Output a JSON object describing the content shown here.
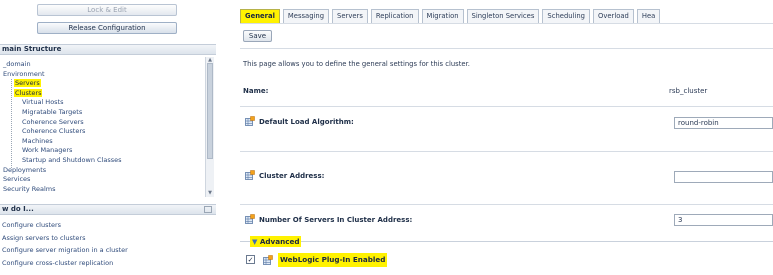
{
  "left": {
    "lock_edit_label": "Lock & Edit",
    "release_configuration_label": "Release Configuration",
    "domain_structure": {
      "title": "main Structure",
      "items": [
        {
          "label": "_domain",
          "indent": 0,
          "highlight": false
        },
        {
          "label": "Environment",
          "indent": 0,
          "highlight": false
        },
        {
          "label": "Servers",
          "indent": 1,
          "highlight": true
        },
        {
          "label": "Clusters",
          "indent": 1,
          "highlight": true
        },
        {
          "label": "Virtual Hosts",
          "indent": 2,
          "highlight": false
        },
        {
          "label": "Migratable Targets",
          "indent": 2,
          "highlight": false
        },
        {
          "label": "Coherence Servers",
          "indent": 2,
          "highlight": false
        },
        {
          "label": "Coherence Clusters",
          "indent": 2,
          "highlight": false
        },
        {
          "label": "Machines",
          "indent": 2,
          "highlight": false
        },
        {
          "label": "Work Managers",
          "indent": 2,
          "highlight": false
        },
        {
          "label": "Startup and Shutdown Classes",
          "indent": 2,
          "highlight": false
        },
        {
          "label": "Deployments",
          "indent": 0,
          "highlight": false
        },
        {
          "label": "Services",
          "indent": 0,
          "highlight": false
        },
        {
          "label": "Security Realms",
          "indent": 0,
          "highlight": false
        }
      ]
    },
    "how_do_i": {
      "title": "w do I...",
      "items": [
        "Configure clusters",
        "Assign servers to clusters",
        "Configure server migration in a cluster",
        "Configure cross-cluster replication"
      ]
    }
  },
  "right": {
    "tabs": [
      {
        "label": "General",
        "active": true
      },
      {
        "label": "Messaging",
        "active": false
      },
      {
        "label": "Servers",
        "active": false
      },
      {
        "label": "Replication",
        "active": false
      },
      {
        "label": "Migration",
        "active": false
      },
      {
        "label": "Singleton Services",
        "active": false
      },
      {
        "label": "Scheduling",
        "active": false
      },
      {
        "label": "Overload",
        "active": false
      },
      {
        "label": "Hea",
        "active": false
      }
    ],
    "save_label": "Save",
    "description": "This page allows you to define the general settings for this cluster.",
    "fields": {
      "name": {
        "label": "Name:",
        "value": "rsb_cluster"
      },
      "default_load_algorithm": {
        "label": "Default Load Algorithm:",
        "value": "round-robin"
      },
      "cluster_address": {
        "label": "Cluster Address:",
        "value": ""
      },
      "number_of_servers": {
        "label": "Number Of Servers In Cluster Address:",
        "value": "3"
      }
    },
    "advanced": {
      "label": "Advanced",
      "weblogic_plugin": {
        "label": "WebLogic Plug-In Enabled",
        "checked": true
      }
    }
  },
  "colors": {
    "highlight": "#fff200",
    "link": "#2e4a7a",
    "border": "#b6c1cf"
  },
  "icons": {
    "field_help": "help-grid-icon",
    "advanced_toggle": "chevron-down-icon"
  }
}
